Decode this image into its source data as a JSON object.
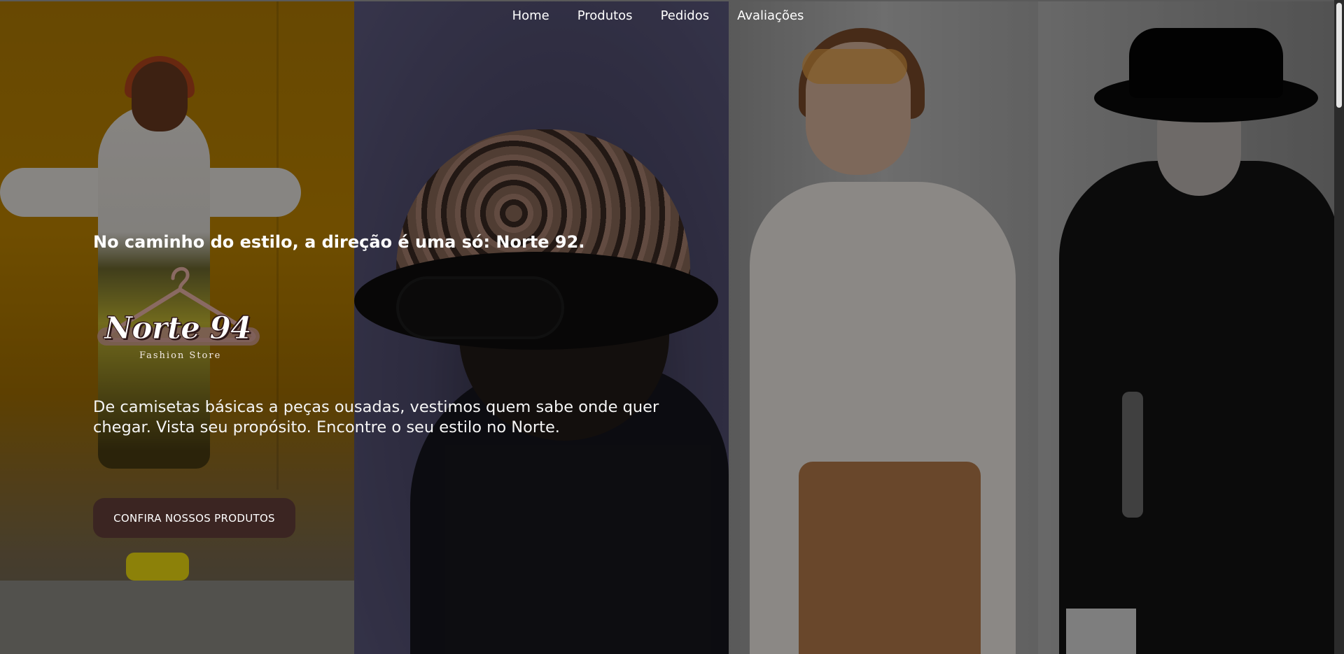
{
  "nav": {
    "items": [
      {
        "label": "Home"
      },
      {
        "label": "Produtos"
      },
      {
        "label": "Pedidos"
      },
      {
        "label": "Avaliações"
      }
    ]
  },
  "hero": {
    "heading": "No caminho do estilo, a direção é uma só: Norte 92.",
    "logo": {
      "wordmark": "Norte 94",
      "subtitle": "Fashion Store",
      "icon": "hanger-icon"
    },
    "description": "De camisetas básicas a peças ousadas, vestimos quem sabe onde quer chegar. Vista seu propósito. Encontre o seu estilo no Norte.",
    "cta_label": "CONFIRA NOSSOS PRODUTOS"
  },
  "colors": {
    "cta_background": "#3b2522",
    "text": "#ffffff",
    "overlay": "rgba(0,0,0,0.42)"
  }
}
